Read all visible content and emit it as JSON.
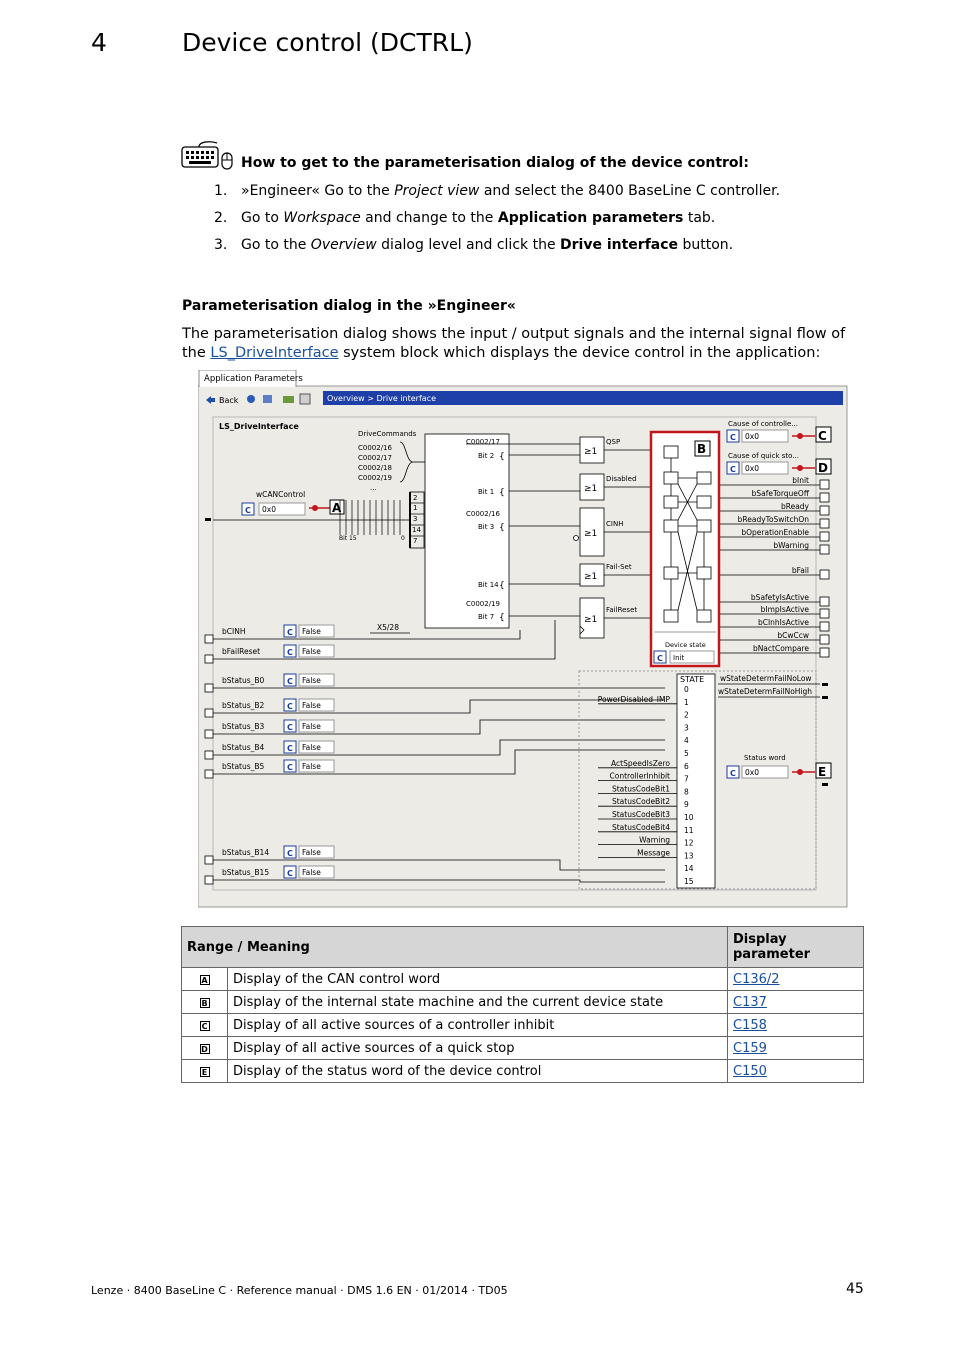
{
  "header": {
    "chapter_number": "4",
    "chapter_title": "Device control (DCTRL)"
  },
  "howto": {
    "title": "How to get to the parameterisation dialog of the device control:",
    "steps": [
      {
        "num": "1.",
        "parts": [
          "»Engineer« Go to the ",
          "Project view",
          " and select the 8400 BaseLine C controller."
        ]
      },
      {
        "num": "2.",
        "parts": [
          "Go to ",
          "Workspace",
          " and change to the ",
          "Application parameters",
          " tab."
        ]
      },
      {
        "num": "3.",
        "parts": [
          "Go to the ",
          "Overview",
          " dialog level and click the ",
          "Drive interface",
          " button."
        ]
      }
    ]
  },
  "section": {
    "title": "Parameterisation dialog in the »Engineer«",
    "para_before": "The parameterisation dialog shows the input / output signals and the internal signal flow of the ",
    "para_link": "LS_DriveInterface",
    "para_after": " system block which displays the device control in the application:"
  },
  "screenshot": {
    "tab_label": "Application Parameters",
    "back_label": "Back",
    "breadcrumb": "Overview > Drive interface",
    "block_title": "LS_DriveInterface",
    "drive_commands": "DriveCommands",
    "codes": [
      "C0002/16",
      "C0002/17",
      "C0002/18",
      "C0002/19",
      "..."
    ],
    "wcancontrol": "wCANControl",
    "wcan_value": "0x0",
    "bit15": "Bit 15",
    "zero": "0",
    "mux_numbers": [
      "2",
      "1",
      "3",
      "14",
      "7"
    ],
    "func_rows": [
      {
        "code": "C0002/17",
        "bit": "Bit 2"
      },
      {
        "code": "",
        "bit": "Bit 1"
      },
      {
        "code": "C0002/16",
        "bit": "Bit 3"
      },
      {
        "code": "",
        "bit": "Bit 14"
      },
      {
        "code": "C0002/19",
        "bit": "Bit 7"
      }
    ],
    "ge1": "≥1",
    "gate_labels": [
      "QSP",
      "Disabled",
      "CINH",
      "Fail-Set",
      "FailReset"
    ],
    "x528": "X5/28",
    "device_state_label": "Device state",
    "device_state_value": "Init",
    "cause_controller": "Cause of controlle...",
    "cause_quickstop": "Cause of quick sto...",
    "cause_values": [
      "0x0",
      "0x0"
    ],
    "outputs": [
      "bInit",
      "bSafeTorqueOff",
      "bReady",
      "bReadyToSwitchOn",
      "bOperationEnable",
      "bWarning",
      "bFail",
      "bSafetyIsActive",
      "bImpIsActive",
      "bCInhIsActive",
      "bCwCcw",
      "bNactCompare"
    ],
    "inputs_top": [
      {
        "name": "bCINH",
        "value": "False"
      },
      {
        "name": "bFailReset",
        "value": "False"
      }
    ],
    "status_inputs": [
      {
        "name": "bStatus_B0",
        "value": "False"
      },
      {
        "name": "bStatus_B2",
        "value": "False"
      },
      {
        "name": "bStatus_B3",
        "value": "False"
      },
      {
        "name": "bStatus_B4",
        "value": "False"
      },
      {
        "name": "bStatus_B5",
        "value": "False"
      },
      {
        "name": "bStatus_B14",
        "value": "False"
      },
      {
        "name": "bStatus_B15",
        "value": "False"
      }
    ],
    "state_label": "STATE",
    "state_numbers": [
      "0",
      "1",
      "2",
      "3",
      "4",
      "5",
      "6",
      "7",
      "8",
      "9",
      "10",
      "11",
      "12",
      "13",
      "14",
      "15"
    ],
    "state_signals": [
      {
        "row": 1,
        "name": "PowerDisabled_IMP"
      },
      {
        "row": 6,
        "name": "ActSpeedIsZero"
      },
      {
        "row": 7,
        "name": "ControllerInhibit"
      },
      {
        "row": 8,
        "name": "StatusCodeBit1"
      },
      {
        "row": 9,
        "name": "StatusCodeBit2"
      },
      {
        "row": 10,
        "name": "StatusCodeBit3"
      },
      {
        "row": 11,
        "name": "StatusCodeBit4"
      },
      {
        "row": 12,
        "name": "Warning"
      },
      {
        "row": 13,
        "name": "Message"
      }
    ],
    "wstate_outputs": [
      "wStateDetermFailNoLow",
      "wStateDetermFailNoHigh"
    ],
    "status_word_label": "Status word",
    "status_word_value": "0x0",
    "c_icon": "C",
    "markers": {
      "A": "A",
      "B": "B",
      "C": "C",
      "D": "D",
      "E": "E"
    }
  },
  "legend_table": {
    "headers": [
      "Range / Meaning",
      "Display parameter"
    ],
    "rows": [
      {
        "key": "A",
        "meaning": "Display of the CAN control word",
        "param": "C136/2"
      },
      {
        "key": "B",
        "meaning": "Display of the internal state machine and the current device state",
        "param": "C137"
      },
      {
        "key": "C",
        "meaning": "Display of all active sources of a controller inhibit",
        "param": "C158"
      },
      {
        "key": "D",
        "meaning": "Display of all active sources of a quick stop",
        "param": "C159"
      },
      {
        "key": "E",
        "meaning": "Display of the status word of the device control",
        "param": "C150"
      }
    ]
  },
  "footer": {
    "text": "Lenze · 8400 BaseLine C · Reference manual · DMS 1.6 EN · 01/2014 · TD05",
    "page": "45"
  },
  "colors": {
    "link": "#1a4fa0",
    "title_bar": "#1f3fa8",
    "marker_red": "#c0161c",
    "c_icon": "#1a3c9c"
  }
}
